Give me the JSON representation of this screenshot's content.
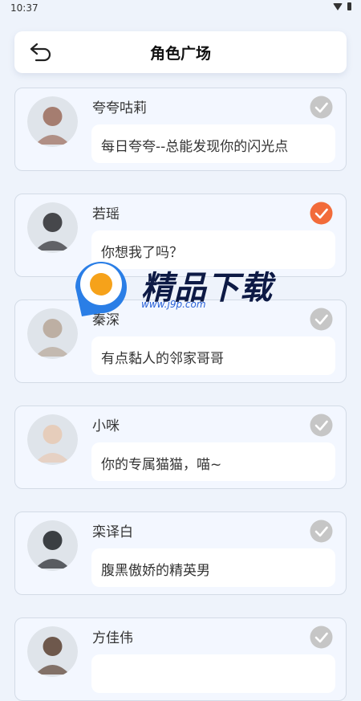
{
  "status_bar": {
    "time": "10:37"
  },
  "header": {
    "title": "角色广场",
    "back_icon": "back-arrow-icon"
  },
  "roles": [
    {
      "name": "夸夸咕莉",
      "desc": "每日夸夸--总能发现你的闪光点",
      "selected": false,
      "avatar_color": "#9b6b5a"
    },
    {
      "name": "若瑶",
      "desc": "你想我了吗？",
      "selected": true,
      "avatar_color": "#2b2b2f"
    },
    {
      "name": "秦深",
      "desc": "有点黏人的邻家哥哥",
      "selected": false,
      "avatar_color": "#b7a697"
    },
    {
      "name": "小咪",
      "desc": "你的专属猫猫，喵~",
      "selected": false,
      "avatar_color": "#e8c9b3"
    },
    {
      "name": "栾译白",
      "desc": "腹黑傲娇的精英男",
      "selected": false,
      "avatar_color": "#1f2226"
    },
    {
      "name": "方佳伟",
      "desc": "",
      "selected": false,
      "avatar_color": "#5a4030"
    }
  ],
  "colors": {
    "selected": "#f26b3a",
    "unselected": "#c6c6c6",
    "card_bg": "#f3f7ff"
  },
  "watermark": {
    "text": "精品下载",
    "url": "www.j9p.com"
  }
}
